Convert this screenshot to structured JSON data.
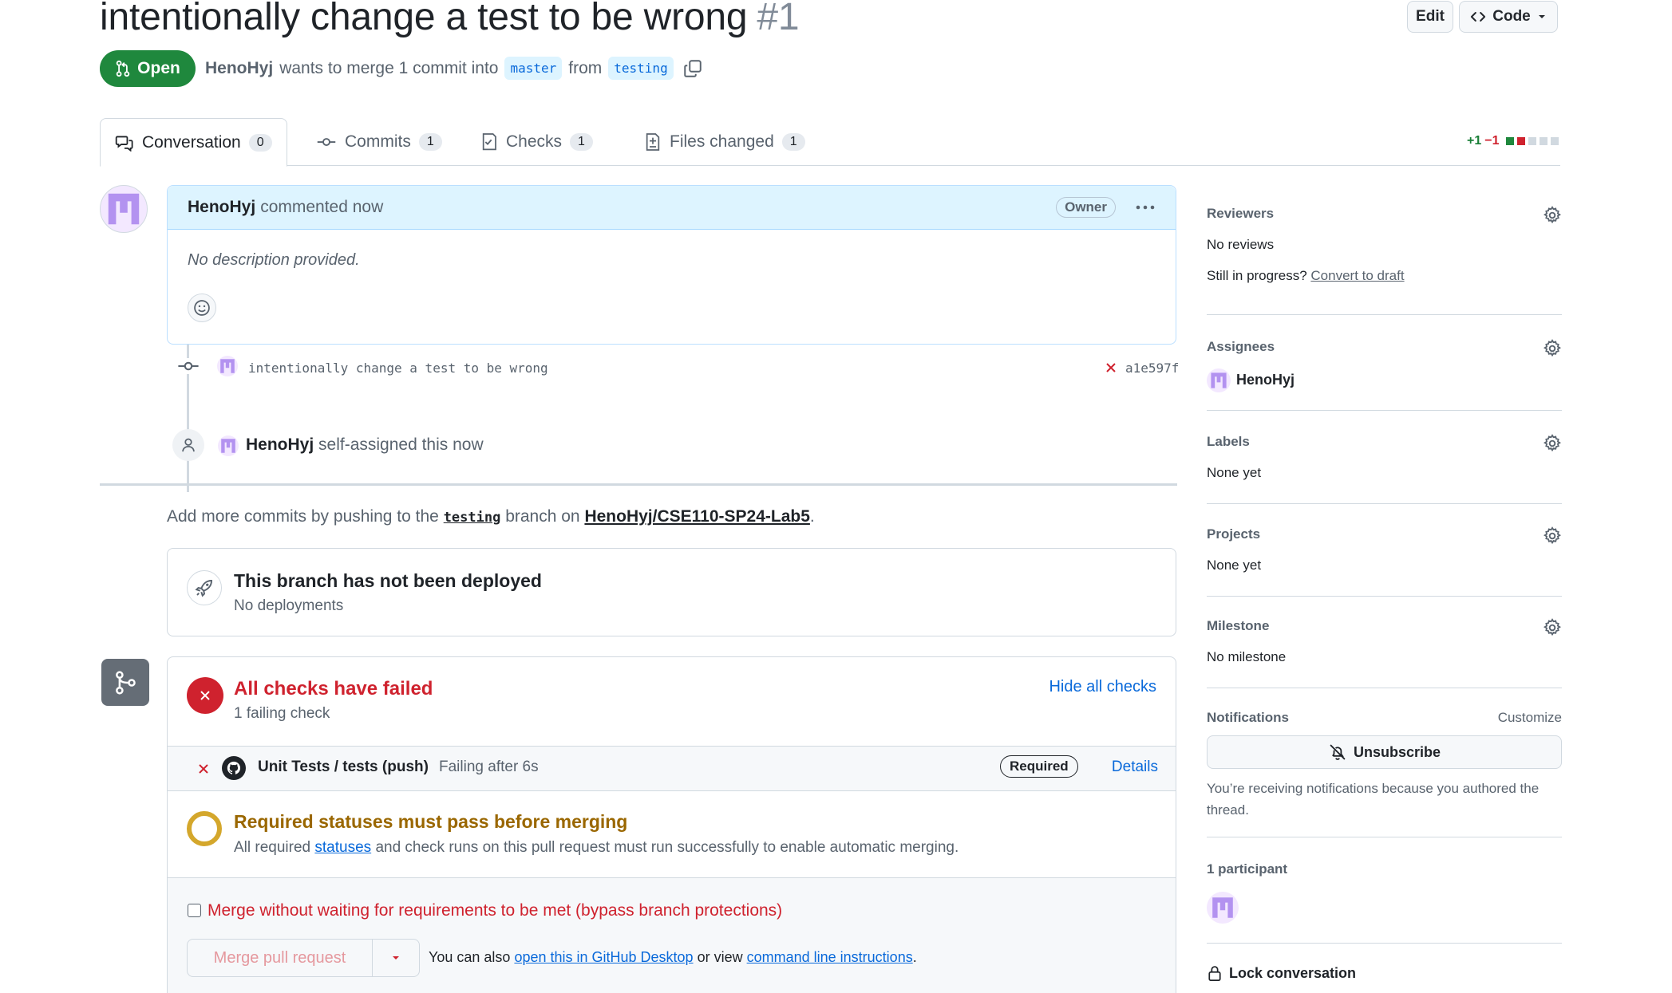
{
  "header": {
    "title": "intentionally change a test to be wrong",
    "number": "#1",
    "edit_label": "Edit",
    "code_label": "Code",
    "state": "Open",
    "author": "HenoHyj",
    "merge_text": "wants to merge 1 commit into",
    "base_branch": "master",
    "from_text": "from",
    "head_branch": "testing"
  },
  "tabs": [
    {
      "label": "Conversation",
      "count": "0"
    },
    {
      "label": "Commits",
      "count": "1"
    },
    {
      "label": "Checks",
      "count": "1"
    },
    {
      "label": "Files changed",
      "count": "1"
    }
  ],
  "diffstat": {
    "additions": "+1",
    "deletions": "−1"
  },
  "comment": {
    "author": "HenoHyj",
    "action": "commented now",
    "badge": "Owner",
    "body": "No description provided."
  },
  "commit": {
    "message": "intentionally change a test to be wrong",
    "sha": "a1e597f"
  },
  "event": {
    "author": "HenoHyj",
    "text": "self-assigned this now"
  },
  "push_hint": {
    "prefix": "Add more commits by pushing to the",
    "branch": "testing",
    "middle": "branch on",
    "repo": "HenoHyj/CSE110-SP24-Lab5",
    "suffix": "."
  },
  "deploy": {
    "title": "This branch has not been deployed",
    "subtitle": "No deployments"
  },
  "checks": {
    "title": "All checks have failed",
    "subtitle": "1 failing check",
    "toggle": "Hide all checks",
    "item_name": "Unit Tests / tests (push)",
    "item_status": "Failing after 6s",
    "item_badge": "Required",
    "item_details": "Details"
  },
  "required": {
    "title": "Required statuses must pass before merging",
    "text_prefix": "All required",
    "text_link": "statuses",
    "text_suffix": "and check runs on this pull request must run successfully to enable automatic merging."
  },
  "merge": {
    "bypass_label": "Merge without waiting for requirements to be met (bypass branch protections)",
    "button_label": "Merge pull request",
    "also_text": "You can also",
    "desktop_link": "open this in GitHub Desktop",
    "or_view": "or view",
    "cli_link": "command line instructions",
    "end": "."
  },
  "sidebar": {
    "reviewers": {
      "title": "Reviewers",
      "value": "No reviews",
      "progress_text": "Still in progress?",
      "draft_link": "Convert to draft"
    },
    "assignees": {
      "title": "Assignees",
      "value": "HenoHyj"
    },
    "labels": {
      "title": "Labels",
      "value": "None yet"
    },
    "projects": {
      "title": "Projects",
      "value": "None yet"
    },
    "milestone": {
      "title": "Milestone",
      "value": "No milestone"
    },
    "notifications": {
      "title": "Notifications",
      "customize": "Customize",
      "button": "Unsubscribe",
      "reason": "You’re receiving notifications because you authored the thread."
    },
    "participants": {
      "title": "1 participant"
    },
    "lock": {
      "label": "Lock conversation"
    }
  },
  "colors": {
    "green": "#1f883d",
    "red": "#cf222e",
    "blue": "#0969da",
    "amber": "#bf8700",
    "avatar_purple": "#b392f0"
  }
}
